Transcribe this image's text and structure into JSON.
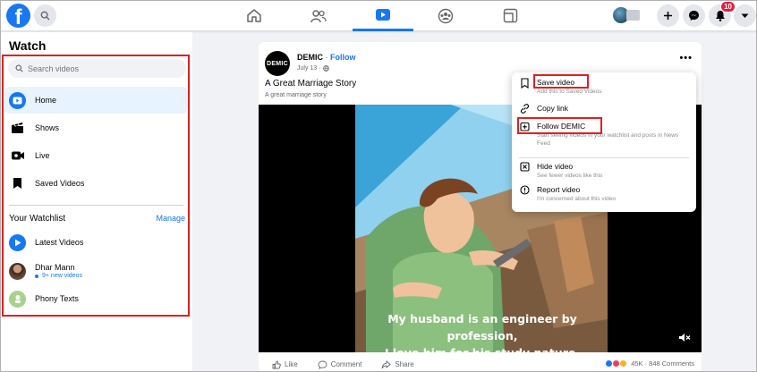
{
  "sidebar": {
    "title": "Watch",
    "search_placeholder": "Search videos",
    "items": [
      {
        "label": "Home"
      },
      {
        "label": "Shows"
      },
      {
        "label": "Live"
      },
      {
        "label": "Saved Videos"
      }
    ],
    "watchlist_title": "Your Watchlist",
    "manage_label": "Manage",
    "watchlist": [
      {
        "label": "Latest Videos"
      },
      {
        "label": "Dhar Mann",
        "sub": "9+ new videos"
      },
      {
        "label": "Phony Texts"
      }
    ]
  },
  "topbar": {
    "logo": "f",
    "notification_count": "10"
  },
  "post": {
    "page_name": "DEMIC",
    "separator": "·",
    "follow_label": "Follow",
    "date": "July 13 ·",
    "avatar_text": "DEMIC",
    "title": "A Great Marriage Story",
    "subtitle": "A great marriage story",
    "caption_line1": "My husband is an engineer by profession,",
    "caption_line2": "I love him for his study nature,",
    "more": "•••",
    "like_label": "Like",
    "comment_label": "Comment",
    "share_label": "Share",
    "reactions_count": "45K",
    "comments_count": "· 848 Comments"
  },
  "menu": {
    "items": [
      {
        "label": "Save video",
        "desc": "Add this to Saved Videos"
      },
      {
        "label": "Copy link",
        "desc": ""
      },
      {
        "label": "Follow DEMIC",
        "desc": "Start seeing videos in your watchlist and posts in News Feed"
      },
      {
        "label": "Hide video",
        "desc": "See fewer videos like this"
      },
      {
        "label": "Report video",
        "desc": "I'm concerned about this video"
      }
    ]
  },
  "colors": {
    "brand": "#1877f2",
    "highlight_box": "#e02020",
    "notification_badge": "#e41e3f"
  },
  "icons": {
    "search": "search-icon",
    "home": "home-icon",
    "friends": "friends-icon",
    "watch": "watch-icon",
    "groups": "groups-icon",
    "gaming": "gaming-icon",
    "plus": "plus-icon",
    "messenger": "messenger-icon",
    "notifications": "bell-icon",
    "account": "chevron-down-icon"
  }
}
